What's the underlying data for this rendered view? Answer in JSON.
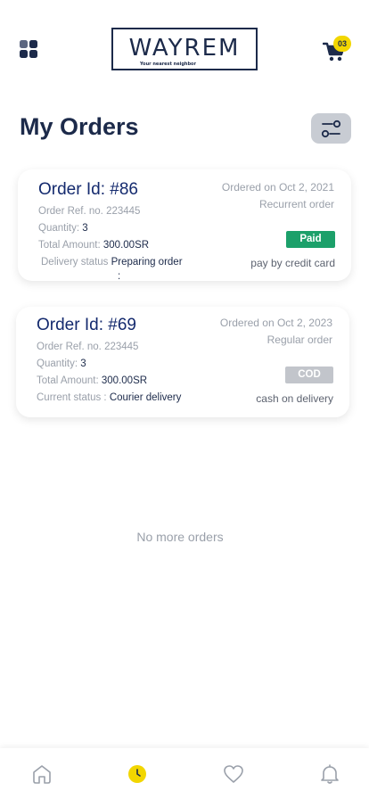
{
  "header": {
    "logo_text": "WAYREM",
    "logo_tagline": "Your nearest neighbor",
    "cart_count": "03"
  },
  "page": {
    "title": "My Orders"
  },
  "orders": [
    {
      "order_id": "Order Id: #86",
      "ref_label": "Order Ref. no.",
      "ref_value": "223445",
      "qty_label": "Quantity:",
      "qty_value": "3",
      "amount_label": "Total Amount:",
      "amount_value": "300.00SR",
      "status_label": "Delivery status",
      "status_colon": ":",
      "status_value": "Preparing order",
      "ordered_on": "Ordered on Oct 2, 2021",
      "order_type": "Recurrent order",
      "payment_badge": "Paid",
      "payment_method": "pay by credit card"
    },
    {
      "order_id": "Order Id: #69",
      "ref_label": "Order Ref. no.",
      "ref_value": "223445",
      "qty_label": "Quantity:",
      "qty_value": "3",
      "amount_label": "Total Amount:",
      "amount_value": "300.00SR",
      "status_label": "Current status :",
      "status_value": "Courier delivery",
      "ordered_on": "Ordered on Oct 2, 2023",
      "order_type": "Regular order",
      "payment_badge": "COD",
      "payment_method": "cash on delivery"
    }
  ],
  "list_footer": "No more orders",
  "colors": {
    "primary": "#1c2a4a",
    "accent_yellow": "#f2d600",
    "paid_green": "#1ca06a",
    "cod_gray": "#c2c5cb"
  },
  "bottom_nav": [
    {
      "icon": "home-icon"
    },
    {
      "icon": "orders-clock-icon",
      "active": true
    },
    {
      "icon": "heart-icon"
    },
    {
      "icon": "bell-icon"
    }
  ]
}
